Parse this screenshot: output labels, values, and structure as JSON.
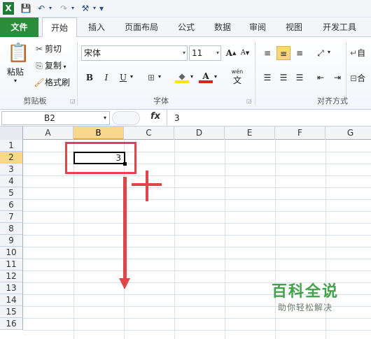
{
  "quick_access": {
    "app_icon": "excel-icon",
    "save_icon": "save-icon",
    "undo_icon": "undo-icon",
    "redo_icon": "redo-icon",
    "tools_icon": "tools-icon",
    "customize_icon": "customize-icon"
  },
  "tabs": [
    {
      "label": "文件"
    },
    {
      "label": "开始"
    },
    {
      "label": "插入"
    },
    {
      "label": "页面布局"
    },
    {
      "label": "公式"
    },
    {
      "label": "数据"
    },
    {
      "label": "审阅"
    },
    {
      "label": "视图"
    },
    {
      "label": "开发工具"
    }
  ],
  "clipboard": {
    "paste": "粘贴",
    "cut": "剪切",
    "copy": "复制",
    "format_painter": "格式刷",
    "group_label": "剪贴板"
  },
  "font": {
    "name": "宋体",
    "size": "11",
    "grow": "A",
    "shrink": "A",
    "bold": "B",
    "italic": "I",
    "underline": "U",
    "font_color": "A",
    "phonetic": "wén",
    "phonetic_char": "文",
    "group_label": "字体"
  },
  "alignment": {
    "group_label": "对齐方式",
    "wrap_text": "自",
    "merge": "合"
  },
  "formula_bar": {
    "name_box": "B2",
    "fx": "fx",
    "value": "3"
  },
  "columns": [
    "A",
    "B",
    "C",
    "D",
    "E",
    "F",
    "G"
  ],
  "rows": [
    "1",
    "2",
    "3",
    "4",
    "5",
    "6",
    "7",
    "8",
    "9",
    "10",
    "11",
    "12",
    "13",
    "14",
    "15",
    "16"
  ],
  "selected_cell": {
    "column": "B",
    "row": "2",
    "value": "3"
  },
  "watermark": {
    "title": "百科全说",
    "subtitle": "助你轻松解决"
  },
  "colors": {
    "annotation": "#e0454a",
    "file_tab": "#2b8d3b",
    "selection": "#f9d88e",
    "watermark": "#3fa34a"
  }
}
